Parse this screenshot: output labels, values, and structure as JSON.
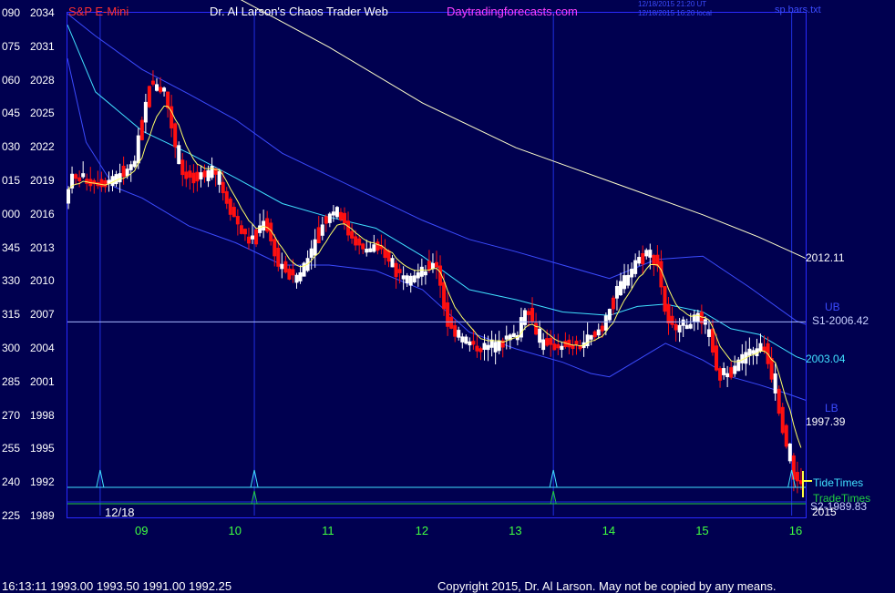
{
  "header": {
    "symbol": "S&P E-Mini",
    "title": "Dr. Al Larson's Chaos Trader Web",
    "site": "Daytradingforecasts.com",
    "stamp_line1": "12/18/2015 21:20 UT",
    "stamp_line2": "12/18/2015 16:20 local",
    "file": "sp.bars.txt"
  },
  "footer": {
    "quote": "16:13:11  1993.00 1993.50 1991.00 1992.25",
    "copyright": "Copyright 2015, Dr. Al Larson. May not be copied by any means."
  },
  "colors": {
    "background": "#000050",
    "frame": "#2a2aff",
    "bull_candle": "#ffffff",
    "bear_candle": "#ff1010",
    "ema_fast": "#ffff66",
    "band_mid": "#40e0ff",
    "band_outer": "#3b4bff",
    "long_ma": "#ffffcc",
    "support_line": "#a8b8ff",
    "tide": "#40e0ff",
    "trade": "#20d040",
    "axis_text": "#ffffff",
    "date_text": "#40ff40",
    "header_red": "#ff3030",
    "header_magenta": "#ff40ff"
  },
  "chart_data": {
    "type": "candlestick",
    "date_label": "12/18",
    "year_label": "2015",
    "ylim": [
      1989,
      2034
    ],
    "y_ticks": [
      {
        "cycle": "090",
        "price": "2034"
      },
      {
        "cycle": "075",
        "price": "2031"
      },
      {
        "cycle": "060",
        "price": "2028"
      },
      {
        "cycle": "045",
        "price": "2025"
      },
      {
        "cycle": "030",
        "price": "2022"
      },
      {
        "cycle": "015",
        "price": "2019"
      },
      {
        "cycle": "000",
        "price": "2016"
      },
      {
        "cycle": "345",
        "price": "2013"
      },
      {
        "cycle": "330",
        "price": "2010"
      },
      {
        "cycle": "315",
        "price": "2007"
      },
      {
        "cycle": "300",
        "price": "2004"
      },
      {
        "cycle": "285",
        "price": "2001"
      },
      {
        "cycle": "270",
        "price": "1998"
      },
      {
        "cycle": "255",
        "price": "1995"
      },
      {
        "cycle": "240",
        "price": "1992"
      },
      {
        "cycle": "225",
        "price": "1989"
      }
    ],
    "x_range": [
      8.2,
      16.1
    ],
    "x_ticks": [
      "09",
      "10",
      "11",
      "12",
      "13",
      "14",
      "15",
      "16"
    ],
    "x_tick_values": [
      9,
      10,
      11,
      12,
      13,
      14,
      15,
      16
    ],
    "tide_times": [
      8.55,
      10.2,
      13.4,
      15.95
    ],
    "trade_times": [
      10.2,
      13.4
    ],
    "support": {
      "value": 2006.42,
      "label": "S1-2006.42"
    },
    "right_labels": {
      "long_ma": "2012.11",
      "upper_band": "UB",
      "mid_band": "2003.04",
      "lower_band": "LB",
      "ema": "1997.39",
      "tide": "TideTimes",
      "trade": "TradeTimes",
      "s2": "S2-1989.83"
    },
    "path_anchors": [
      [
        8.2,
        2017.2
      ],
      [
        8.3,
        2019.5
      ],
      [
        8.5,
        2019.0
      ],
      [
        8.7,
        2019.0
      ],
      [
        8.95,
        2020.4
      ],
      [
        9.12,
        2027.8
      ],
      [
        9.28,
        2027.0
      ],
      [
        9.45,
        2020.0
      ],
      [
        9.62,
        2019.0
      ],
      [
        9.8,
        2020.3
      ],
      [
        9.95,
        2017.2
      ],
      [
        10.1,
        2014.5
      ],
      [
        10.2,
        2013.5
      ],
      [
        10.35,
        2015.7
      ],
      [
        10.5,
        2011.5
      ],
      [
        10.7,
        2010.1
      ],
      [
        10.85,
        2013.0
      ],
      [
        10.98,
        2015.5
      ],
      [
        11.12,
        2016.5
      ],
      [
        11.25,
        2014.5
      ],
      [
        11.4,
        2012.8
      ],
      [
        11.6,
        2013.0
      ],
      [
        11.75,
        2011.0
      ],
      [
        11.9,
        2010.3
      ],
      [
        12.05,
        2010.8
      ],
      [
        12.18,
        2012.0
      ],
      [
        12.3,
        2006.5
      ],
      [
        12.5,
        2004.5
      ],
      [
        12.7,
        2004.0
      ],
      [
        12.85,
        2004.6
      ],
      [
        13.05,
        2005.2
      ],
      [
        13.15,
        2008.0
      ],
      [
        13.3,
        2004.5
      ],
      [
        13.5,
        2004.3
      ],
      [
        13.75,
        2004.3
      ],
      [
        13.95,
        2005.8
      ],
      [
        14.08,
        2008.5
      ],
      [
        14.25,
        2010.8
      ],
      [
        14.4,
        2012.6
      ],
      [
        14.55,
        2012.0
      ],
      [
        14.65,
        2006.5
      ],
      [
        14.8,
        2006.0
      ],
      [
        15.0,
        2006.7
      ],
      [
        15.1,
        2005.5
      ],
      [
        15.2,
        2001.5
      ],
      [
        15.35,
        2002.3
      ],
      [
        15.55,
        2003.7
      ],
      [
        15.7,
        2004.2
      ],
      [
        15.8,
        2001.0
      ],
      [
        15.9,
        1996.8
      ],
      [
        16.02,
        1992.3
      ],
      [
        16.1,
        1992.2
      ]
    ],
    "long_ma_points": [
      [
        8.9,
        2036.0
      ],
      [
        10.0,
        2035.5
      ],
      [
        11.0,
        2031.0
      ],
      [
        12.0,
        2026.0
      ],
      [
        13.0,
        2022.0
      ],
      [
        14.0,
        2019.0
      ],
      [
        15.0,
        2016.0
      ],
      [
        15.6,
        2014.0
      ],
      [
        16.1,
        2012.1
      ]
    ],
    "upper_band_points": [
      [
        8.2,
        2034.0
      ],
      [
        8.5,
        2032.0
      ],
      [
        9.0,
        2029.0
      ],
      [
        9.5,
        2026.8
      ],
      [
        10.0,
        2024.5
      ],
      [
        10.5,
        2021.5
      ],
      [
        11.0,
        2019.5
      ],
      [
        11.5,
        2017.5
      ],
      [
        12.0,
        2015.5
      ],
      [
        12.5,
        2013.8
      ],
      [
        13.0,
        2012.7
      ],
      [
        13.5,
        2011.5
      ],
      [
        14.0,
        2010.3
      ],
      [
        14.5,
        2012.0
      ],
      [
        15.0,
        2012.3
      ],
      [
        15.5,
        2009.5
      ],
      [
        16.0,
        2006.5
      ],
      [
        16.1,
        2006.2
      ]
    ],
    "mid_band_points": [
      [
        8.2,
        2033.0
      ],
      [
        8.5,
        2027.0
      ],
      [
        9.0,
        2023.5
      ],
      [
        9.5,
        2021.5
      ],
      [
        10.0,
        2019.3
      ],
      [
        10.5,
        2017.0
      ],
      [
        11.0,
        2015.8
      ],
      [
        11.5,
        2014.8
      ],
      [
        12.0,
        2012.3
      ],
      [
        12.5,
        2009.3
      ],
      [
        13.0,
        2008.4
      ],
      [
        13.5,
        2007.3
      ],
      [
        14.0,
        2007.0
      ],
      [
        14.3,
        2007.8
      ],
      [
        14.6,
        2008.0
      ],
      [
        15.0,
        2007.3
      ],
      [
        15.3,
        2005.8
      ],
      [
        15.6,
        2005.3
      ],
      [
        16.0,
        2003.3
      ],
      [
        16.1,
        2003.0
      ]
    ],
    "lower_band_points": [
      [
        8.2,
        2030.0
      ],
      [
        8.4,
        2022.5
      ],
      [
        8.7,
        2018.5
      ],
      [
        9.0,
        2017.5
      ],
      [
        9.5,
        2015.0
      ],
      [
        10.0,
        2013.5
      ],
      [
        10.5,
        2011.5
      ],
      [
        11.0,
        2011.5
      ],
      [
        11.5,
        2011.0
      ],
      [
        12.0,
        2009.3
      ],
      [
        12.5,
        2005.5
      ],
      [
        13.0,
        2004.0
      ],
      [
        13.5,
        2002.8
      ],
      [
        13.8,
        2001.8
      ],
      [
        14.0,
        2001.5
      ],
      [
        14.3,
        2003.0
      ],
      [
        14.6,
        2004.5
      ],
      [
        15.0,
        2003.0
      ],
      [
        15.3,
        2001.5
      ],
      [
        15.6,
        2000.8
      ],
      [
        15.9,
        2000.0
      ],
      [
        16.1,
        1999.4
      ]
    ]
  }
}
